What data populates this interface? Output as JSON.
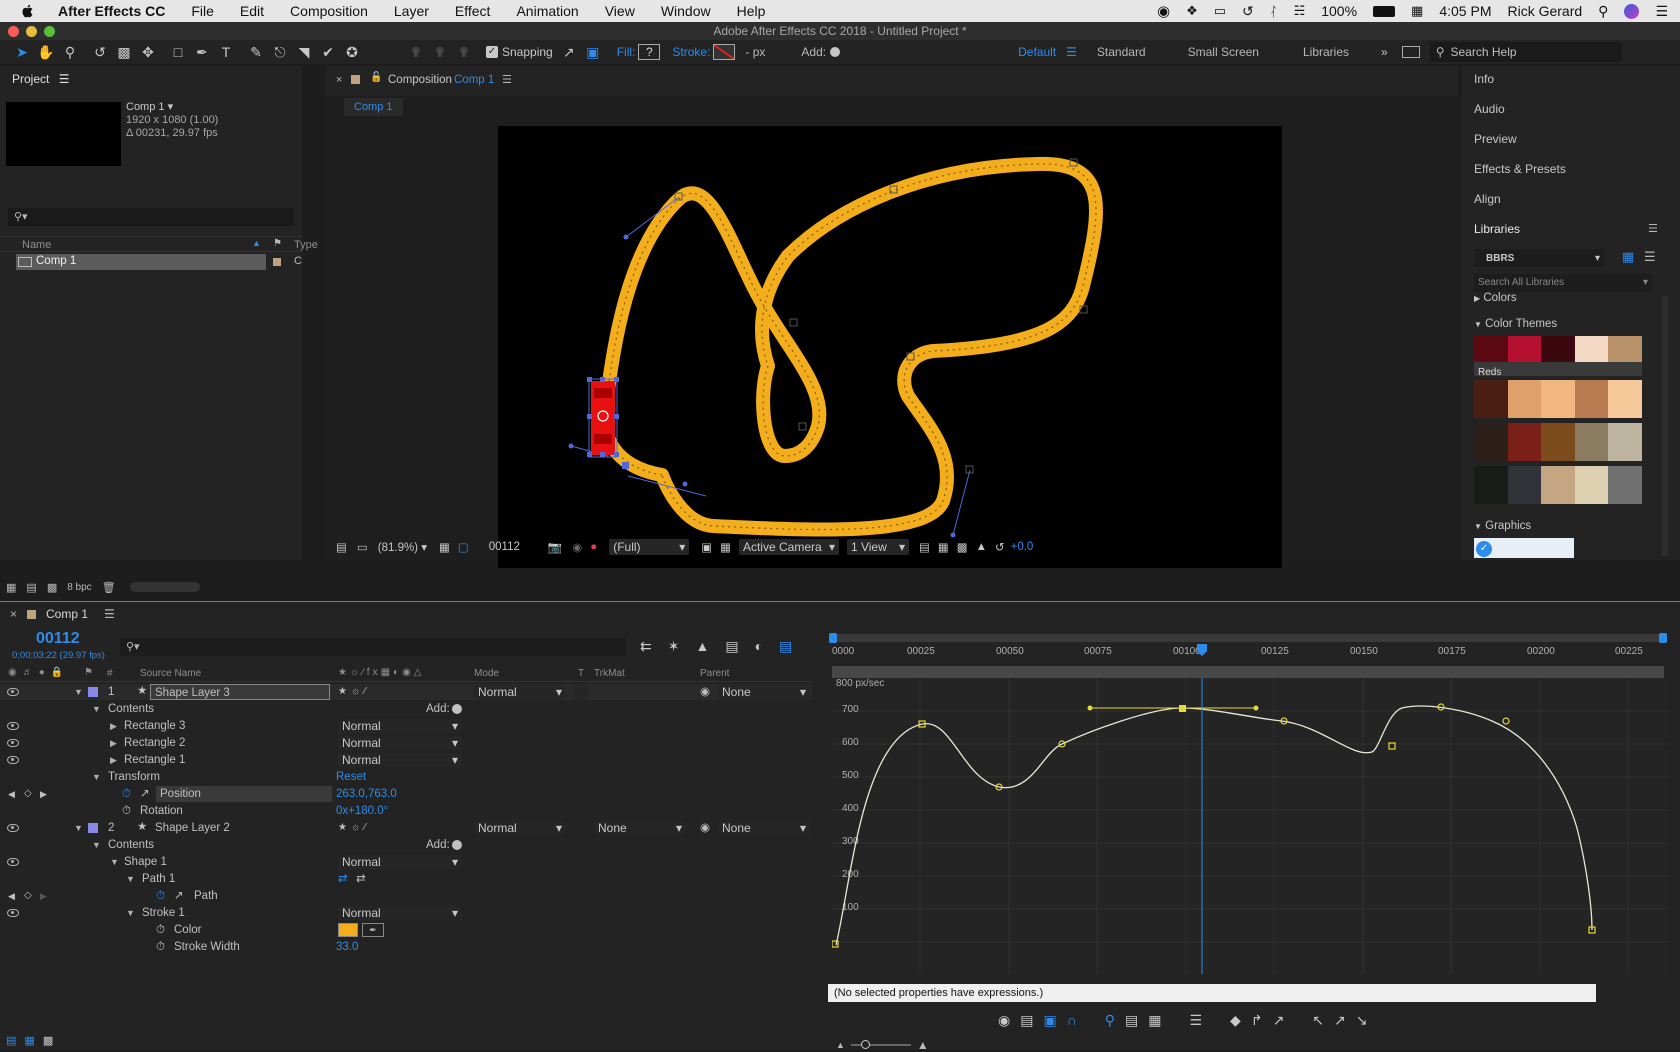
{
  "menubar": {
    "app": "After Effects CC",
    "items": [
      "File",
      "Edit",
      "Composition",
      "Layer",
      "Effect",
      "Animation",
      "View",
      "Window",
      "Help"
    ],
    "battery": "100%",
    "time": "4:05 PM",
    "user": "Rick Gerard"
  },
  "window": {
    "title": "Adobe After Effects CC 2018 - Untitled Project *"
  },
  "toolbar": {
    "snapping": "Snapping",
    "fill": "Fill:",
    "fill_value": "?",
    "stroke": "Stroke:",
    "stroke_px": "- px",
    "add": "Add:",
    "workspaces": [
      "Default",
      "Standard",
      "Small Screen",
      "Libraries"
    ],
    "search_placeholder": "Search Help"
  },
  "project": {
    "tab": "Project",
    "comp_name": "Comp 1 ▾",
    "comp_res": "1920 x 1080 (1.00)",
    "comp_dur": "Δ 00231, 29.97 fps",
    "col_name": "Name",
    "col_type": "Type",
    "item": "Comp 1",
    "item_type": "C",
    "bpc": "8 bpc"
  },
  "composition": {
    "tab_prefix": "Composition",
    "tab_name": "Comp 1",
    "breadcrumb": "Comp 1",
    "zoom": "(81.9%)",
    "frame": "00112",
    "resolution": "(Full)",
    "camera": "Active Camera",
    "views": "1 View",
    "exposure": "+0.0"
  },
  "right_panels": {
    "items": [
      "Info",
      "Audio",
      "Preview",
      "Effects & Presets",
      "Align"
    ],
    "libraries": "Libraries",
    "library_name": "BBRS",
    "search_placeholder": "Search All Libraries",
    "colors": "Colors",
    "color_themes": "Color Themes",
    "reds_label": "Reds",
    "graphics": "Graphics",
    "theme_rows": [
      [
        "#5c0a12",
        "#b5102f",
        "#3c0810",
        "#f4dac4",
        "#b8906a"
      ],
      [
        "#4b1e14",
        "#e0a06a",
        "#f0b87e",
        "#b87a50",
        "#f6c89a"
      ],
      [
        "#2c1e18",
        "#7a2018",
        "#7c4c1c",
        "#8c7c62",
        "#bcb49e"
      ],
      [
        "#181c18",
        "#303438",
        "#c4a682",
        "#ddd0b0",
        "#707070"
      ]
    ]
  },
  "timeline": {
    "tab": "Comp 1",
    "timecode": "00112",
    "timecode_sub": "0;00;03;22 (29.97 fps)",
    "cols": {
      "num": "#",
      "source": "Source Name",
      "mode": "Mode",
      "t": "T",
      "trkmat": "TrkMat",
      "parent": "Parent"
    },
    "layers": [
      {
        "num": "1",
        "name": "Shape Layer 3",
        "mode": "Normal",
        "parent": "None"
      },
      {
        "num": "2",
        "name": "Shape Layer 2",
        "mode": "Normal",
        "trkmat": "None",
        "parent": "None"
      }
    ],
    "rows": {
      "contents": "Contents",
      "add": "Add:",
      "rect3": "Rectangle 3",
      "rect2": "Rectangle 2",
      "rect1": "Rectangle 1",
      "normal": "Normal",
      "transform": "Transform",
      "reset": "Reset",
      "position": "Position",
      "position_val": "263.0,763.0",
      "rotation": "Rotation",
      "rotation_val": "0x+180.0°",
      "contents2": "Contents",
      "shape1": "Shape 1",
      "path1": "Path 1",
      "path": "Path",
      "stroke1": "Stroke 1",
      "color": "Color",
      "stroke_width": "Stroke Width",
      "stroke_width_val": "33.0"
    },
    "ruler": [
      "0000",
      "00025",
      "00050",
      "00075",
      "00100",
      "00125",
      "00150",
      "00175",
      "00200",
      "00225"
    ],
    "graph_unit": "800 px/sec",
    "graph_labels": [
      "700",
      "600",
      "500",
      "400",
      "300",
      "200",
      "100"
    ],
    "expression_msg": "(No selected properties have expressions.)"
  },
  "colors": {
    "accent": "#2d8ceb",
    "stroke_yellow": "#f4ae1c",
    "shape_red": "#e81010",
    "panel": "#232323"
  }
}
